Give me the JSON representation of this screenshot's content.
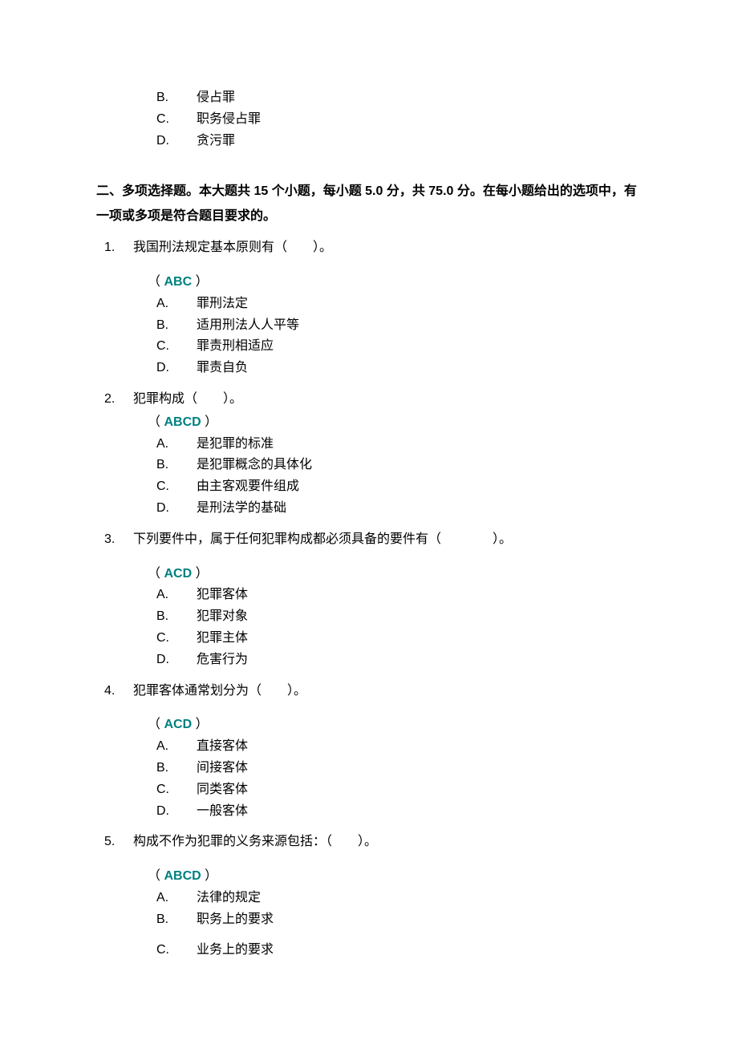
{
  "top_options": {
    "b": {
      "letter": "B.",
      "text": "侵占罪"
    },
    "c": {
      "letter": "C.",
      "text": "职务侵占罪"
    },
    "d": {
      "letter": "D.",
      "text": "贪污罪"
    }
  },
  "section_heading": "二、多项选择题。本大题共 15 个小题，每小题 5.0 分，共 75.0 分。在每小题给出的选项中，有一项或多项是符合题目要求的。",
  "questions": [
    {
      "num": "1.",
      "stem": "我国刑法规定基本原则有（　　）。",
      "answer": "ABC",
      "options": [
        {
          "letter": "A.",
          "text": "罪刑法定"
        },
        {
          "letter": "B.",
          "text": "适用刑法人人平等"
        },
        {
          "letter": "C.",
          "text": "罪责刑相适应"
        },
        {
          "letter": "D.",
          "text": "罪责自负"
        }
      ],
      "gap_before_answer": true
    },
    {
      "num": "2.",
      "stem": "犯罪构成（　　）。",
      "answer": "ABCD",
      "options": [
        {
          "letter": "A.",
          "text": "是犯罪的标准"
        },
        {
          "letter": "B.",
          "text": "是犯罪概念的具体化"
        },
        {
          "letter": "C.",
          "text": "由主客观要件组成"
        },
        {
          "letter": "D.",
          "text": "是刑法学的基础"
        }
      ],
      "gap_before_answer": false
    },
    {
      "num": "3.",
      "stem": "下列要件中，属于任何犯罪构成都必须具备的要件有（　　　　）。",
      "answer": "ACD",
      "options": [
        {
          "letter": "A.",
          "text": "犯罪客体"
        },
        {
          "letter": "B.",
          "text": "犯罪对象"
        },
        {
          "letter": "C.",
          "text": "犯罪主体"
        },
        {
          "letter": "D.",
          "text": "危害行为"
        }
      ],
      "gap_before_answer": true
    },
    {
      "num": "4.",
      "stem": "犯罪客体通常划分为（　　）。",
      "answer": "ACD",
      "options": [
        {
          "letter": "A.",
          "text": "直接客体"
        },
        {
          "letter": "B.",
          "text": "间接客体"
        },
        {
          "letter": "C.",
          "text": "同类客体"
        },
        {
          "letter": "D.",
          "text": "一般客体"
        }
      ],
      "gap_before_answer": true
    },
    {
      "num": "5.",
      "stem": "构成不作为犯罪的义务来源包括：（　　）。",
      "answer": "ABCD",
      "options": [
        {
          "letter": "A.",
          "text": "法律的规定"
        },
        {
          "letter": "B.",
          "text": "职务上的要求"
        },
        {
          "letter": "C.",
          "text": "业务上的要求"
        }
      ],
      "gap_before_answer": true,
      "gap_before_c": true
    }
  ]
}
